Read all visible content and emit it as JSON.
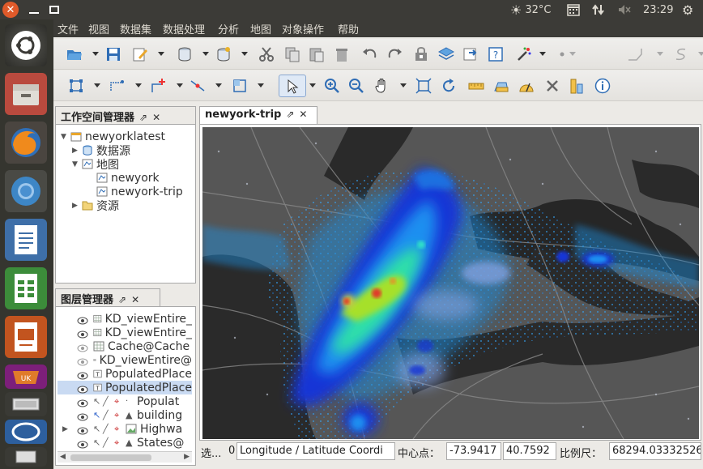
{
  "topbar": {
    "temperature": "32°C",
    "time": "23:29"
  },
  "menubar": {
    "items": [
      "文件",
      "视图",
      "数据集",
      "数据处理",
      "分析",
      "地图",
      "对象操作",
      "帮助"
    ]
  },
  "workspace": {
    "title": "工作空间管理器",
    "root": "newyorklatest",
    "datasources": "数据源",
    "maps": "地图",
    "map_items": [
      "newyork",
      "newyork-trip"
    ],
    "resources": "资源"
  },
  "layers": {
    "title": "图层管理器",
    "items": [
      "KD_viewEntire_",
      "KD_viewEntire_",
      "Cache@Cache",
      "KD_viewEntire@",
      "PopulatedPlace",
      "PopulatedPlace",
      "Populat",
      "building",
      "Highwa",
      "States@"
    ]
  },
  "map_tab": {
    "title": "newyork-trip"
  },
  "status": {
    "select_label": "选...",
    "count": "0",
    "coord_system": "Longitude / Latitude Coordi",
    "center_label": "中心点：",
    "center_x": "-73.9417",
    "center_y": "40.7592",
    "scale_label": "比例尺：",
    "scale_value": "68294.03332526"
  },
  "colors": {
    "accent": "#e05a2a",
    "map_water": "#2a2a2a",
    "map_land": "#555555",
    "map_points": "#2aa6ff"
  }
}
